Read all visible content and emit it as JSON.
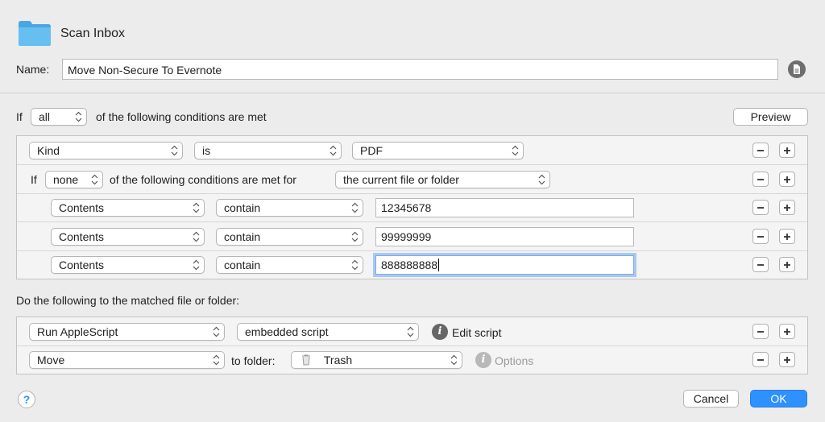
{
  "header": {
    "title": "Scan Inbox",
    "name_label": "Name:",
    "name_value": "Move Non-Secure To Evernote"
  },
  "conditions": {
    "if_label": "If",
    "match_value": "all",
    "suffix": "of the following conditions are met",
    "preview_label": "Preview",
    "rows": [
      {
        "field": "Kind",
        "operator": "is",
        "value": "PDF"
      },
      {
        "if_label": "If",
        "match_value": "none",
        "suffix": "of the following conditions are met for",
        "target": "the current file or folder"
      },
      {
        "field": "Contents",
        "operator": "contain",
        "value": "12345678"
      },
      {
        "field": "Contents",
        "operator": "contain",
        "value": "99999999"
      },
      {
        "field": "Contents",
        "operator": "contain",
        "value": "888888888"
      }
    ]
  },
  "actions": {
    "heading": "Do the following to the matched file or folder:",
    "rows": [
      {
        "action": "Run AppleScript",
        "param": "embedded script",
        "link_label": "Edit script"
      },
      {
        "action": "Move",
        "to_label": "to folder:",
        "folder": "Trash",
        "link_label": "Options"
      }
    ]
  },
  "footer": {
    "help_label": "?",
    "cancel_label": "Cancel",
    "ok_label": "OK"
  },
  "colors": {
    "accent": "#2f90ff",
    "folder": "#5ab2ea",
    "focus_ring": "#a8c8f1"
  },
  "icons": [
    "folder-icon",
    "document-icon",
    "popup-arrows-icon",
    "minus-icon",
    "plus-icon",
    "info-icon",
    "trash-icon",
    "help-icon"
  ]
}
